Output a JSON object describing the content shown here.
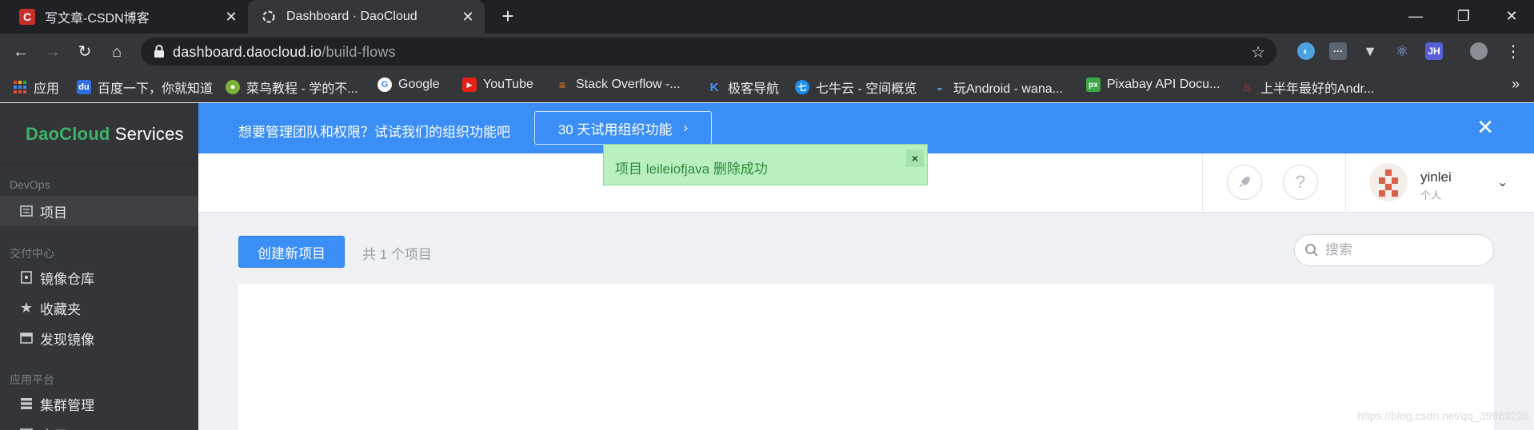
{
  "browser": {
    "tabs": [
      {
        "title": "写文章-CSDN博客",
        "icon": "csdn-icon",
        "active": false
      },
      {
        "title": "Dashboard · DaoCloud",
        "icon": "daocloud-icon",
        "active": true
      }
    ],
    "url_domain": "dashboard.daocloud.io",
    "url_path": "/build-flows",
    "bookmarks": [
      {
        "label": "应用",
        "icon": "apps-grid-icon"
      },
      {
        "label": "百度一下，你就知道",
        "icon": "baidu-icon"
      },
      {
        "label": "菜鸟教程 - 学的不...",
        "icon": "runoob-icon"
      },
      {
        "label": "Google",
        "icon": "google-icon"
      },
      {
        "label": "YouTube",
        "icon": "youtube-icon"
      },
      {
        "label": "Stack Overflow -...",
        "icon": "stackoverflow-icon"
      },
      {
        "label": "极客导航",
        "icon": "jike-icon"
      },
      {
        "label": "七牛云 - 空间概览",
        "icon": "qiniu-icon"
      },
      {
        "label": "玩Android - wana...",
        "icon": "android-icon"
      },
      {
        "label": "Pixabay API Docu...",
        "icon": "pixabay-icon"
      },
      {
        "label": "上半年最好的Andr...",
        "icon": "fire-icon"
      }
    ]
  },
  "sidebar": {
    "brand_dao": "DaoCloud",
    "brand_rest": " Services",
    "sections": [
      {
        "title": "DevOps",
        "items": [
          {
            "label": "项目",
            "icon": "project-icon",
            "active": true
          }
        ]
      },
      {
        "title": "交付中心",
        "items": [
          {
            "label": "镜像仓库",
            "icon": "image-repo-icon"
          },
          {
            "label": "收藏夹",
            "icon": "star-icon"
          },
          {
            "label": "发现镜像",
            "icon": "discover-icon"
          }
        ]
      },
      {
        "title": "应用平台",
        "items": [
          {
            "label": "集群管理",
            "icon": "cluster-icon"
          },
          {
            "label": "应用",
            "icon": "app-icon"
          }
        ]
      }
    ]
  },
  "banner": {
    "message": "想要管理团队和权限？试试我们的组织功能吧",
    "trial_button": "30 天试用组织功能",
    "close_glyph": "✕"
  },
  "header": {
    "username": "yinlei",
    "role": "个人"
  },
  "toast": {
    "message": "项目 leileiofjava 删除成功",
    "close_glyph": "×"
  },
  "main": {
    "create_button": "创建新项目",
    "count_text": "共 1 个项目",
    "search_placeholder": "搜索"
  },
  "watermark": "https://blog.csdn.net/qq_39969226",
  "colors": {
    "primary": "#3a8ef6",
    "sidebar_bg": "#333538",
    "brand_green": "#3fb26a",
    "toast_bg": "#b9f0bf"
  }
}
